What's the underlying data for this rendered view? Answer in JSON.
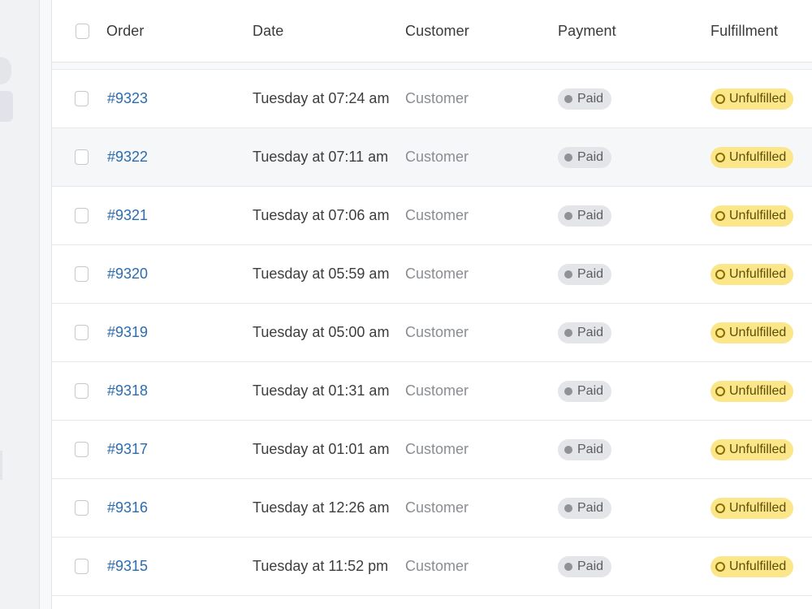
{
  "table": {
    "headers": {
      "order": "Order",
      "date": "Date",
      "customer": "Customer",
      "payment": "Payment",
      "fulfillment": "Fulfillment"
    },
    "rows": [
      {
        "order": "#9323",
        "date": "Tuesday at 07:24 am",
        "customer": "Customer",
        "payment": "Paid",
        "fulfillment": "Unfulfilled"
      },
      {
        "order": "#9322",
        "date": "Tuesday at 07:11 am",
        "customer": "Customer",
        "payment": "Paid",
        "fulfillment": "Unfulfilled"
      },
      {
        "order": "#9321",
        "date": "Tuesday at 07:06 am",
        "customer": "Customer",
        "payment": "Paid",
        "fulfillment": "Unfulfilled"
      },
      {
        "order": "#9320",
        "date": "Tuesday at 05:59 am",
        "customer": "Customer",
        "payment": "Paid",
        "fulfillment": "Unfulfilled"
      },
      {
        "order": "#9319",
        "date": "Tuesday at 05:00 am",
        "customer": "Customer",
        "payment": "Paid",
        "fulfillment": "Unfulfilled"
      },
      {
        "order": "#9318",
        "date": "Tuesday at 01:31 am",
        "customer": "Customer",
        "payment": "Paid",
        "fulfillment": "Unfulfilled"
      },
      {
        "order": "#9317",
        "date": "Tuesday at 01:01 am",
        "customer": "Customer",
        "payment": "Paid",
        "fulfillment": "Unfulfilled"
      },
      {
        "order": "#9316",
        "date": "Tuesday at 12:26 am",
        "customer": "Customer",
        "payment": "Paid",
        "fulfillment": "Unfulfilled"
      },
      {
        "order": "#9315",
        "date": "Tuesday at 11:52 pm",
        "customer": "Customer",
        "payment": "Paid",
        "fulfillment": "Unfulfilled"
      }
    ]
  },
  "colors": {
    "order_link": "#2b6cb0",
    "paid_badge_bg": "#e3e5e8",
    "unfulfilled_badge_bg": "#fbe78a"
  },
  "icons": {
    "paid": "paid-dot-icon",
    "unfulfilled": "unfulfilled-ring-icon"
  }
}
